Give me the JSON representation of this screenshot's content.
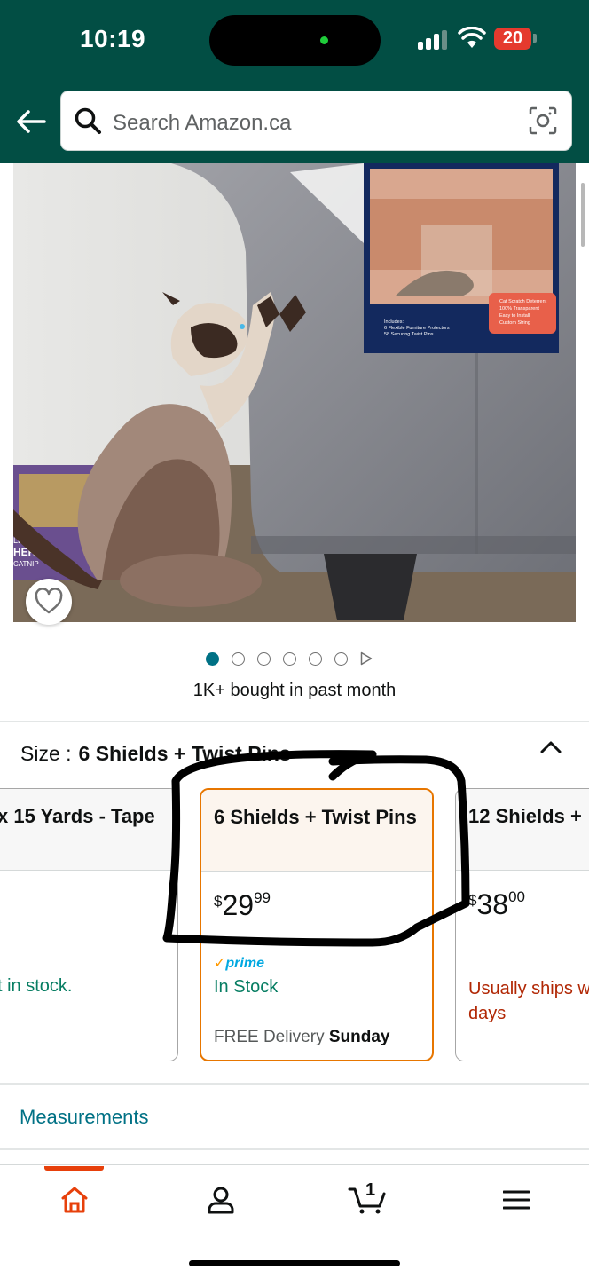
{
  "status_bar": {
    "time": "10:19",
    "battery": "20"
  },
  "search": {
    "placeholder": "Search Amazon.ca",
    "icon": "search-icon",
    "camera_icon": "camera-lens-icon"
  },
  "product_image": {
    "packaging_text_lines": [
      "Includes:",
      "6 Flexible Furniture Protectors",
      "58 Securing Twist Pins"
    ],
    "badge_lines": [
      "Cat Scratch Deterrent",
      "100% Transparent",
      "Easy to Install",
      "Custom String"
    ],
    "mat_text": [
      "LE",
      "HER",
      "CATNIP"
    ]
  },
  "carousel": {
    "count": 6,
    "active_index": 0,
    "play_icon": "play-icon"
  },
  "social_proof": "1K+ bought in past month",
  "size": {
    "label": "Size :",
    "selected_value": "6 Shields + Twist Pins"
  },
  "options": [
    {
      "name": "x 15 Yards - Tape",
      "availability": "t in stock."
    },
    {
      "name": "6 Shields + Twist Pins",
      "price_currency": "$",
      "price_whole": "29",
      "price_fraction": "99",
      "prime": "prime",
      "availability": "In Stock",
      "delivery_prefix": "FREE Delivery",
      "delivery_day": "Sunday"
    },
    {
      "name": "12 Shields +",
      "price_currency": "$",
      "price_whole": "38",
      "price_fraction": "00",
      "availability": "Usually ships w days"
    }
  ],
  "measurements_link": "Measurements",
  "bottom_nav": {
    "cart_count": "1",
    "items": [
      "home-icon",
      "account-icon",
      "cart-icon",
      "menu-icon"
    ]
  },
  "colors": {
    "header": "#024e44",
    "link": "#007185",
    "in_stock": "#067d62",
    "selected_border": "#e77600",
    "nav_active": "#e7400b"
  }
}
